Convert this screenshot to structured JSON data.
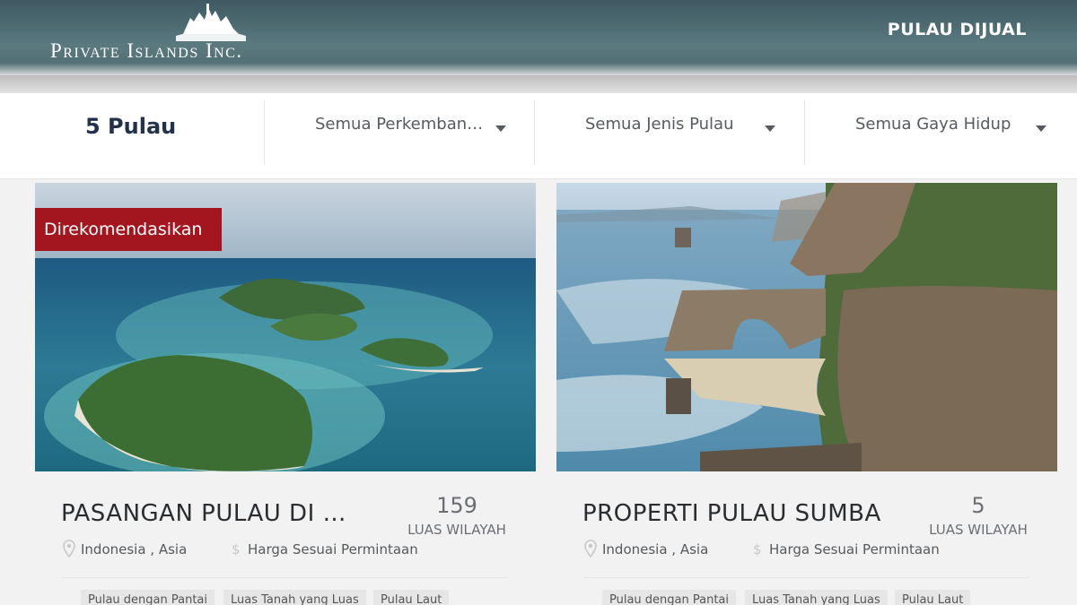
{
  "header": {
    "logo_text": "Private Islands Inc.",
    "nav_link": "PULAU DIJUAL"
  },
  "filters": {
    "count": "5 Pulau",
    "development": "Semua Perkemban…",
    "island_type": "Semua Jenis Pulau",
    "lifestyle": "Semua Gaya Hidup"
  },
  "listings": [
    {
      "badge": "Direkomendasikan",
      "title": "PASANGAN PULAU DI …",
      "area": "159",
      "area_label": "LUAS WILAYAH",
      "location": "Indonesia , Asia",
      "price": "Harga Sesuai Permintaan",
      "tags": [
        "Pulau dengan Pantai",
        "Luas Tanah yang Luas",
        "Pulau Laut"
      ]
    },
    {
      "badge": "",
      "title": "PROPERTI PULAU SUMBA",
      "area": "5",
      "area_label": "LUAS WILAYAH",
      "location": "Indonesia , Asia",
      "price": "Harga Sesuai Permintaan",
      "tags": [
        "Pulau dengan Pantai",
        "Luas Tanah yang Luas",
        "Pulau Laut"
      ]
    }
  ],
  "icons": {
    "location": "map-pin-icon",
    "price": "dollar-icon",
    "dropdown": "caret-down-icon"
  },
  "colors": {
    "badge": "#a3161f",
    "count_text": "#23314a",
    "header_bg": "#4e6b72"
  }
}
